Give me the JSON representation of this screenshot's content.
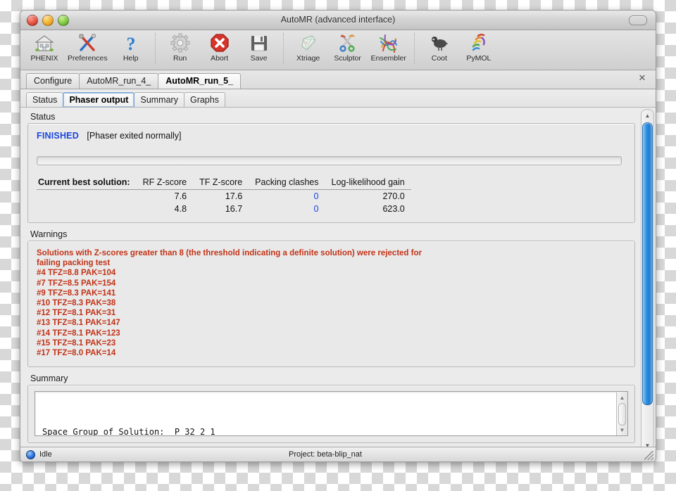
{
  "window": {
    "title": "AutoMR (advanced interface)",
    "traffic_lights": [
      "close",
      "minimize",
      "zoom"
    ],
    "toolbar_toggle": "toolbar-toggle"
  },
  "toolbar": {
    "groups": [
      {
        "items": [
          {
            "label": "PHENIX",
            "icon": "house-icon"
          },
          {
            "label": "Preferences",
            "icon": "tools-icon"
          },
          {
            "label": "Help",
            "icon": "question-mark-icon"
          }
        ]
      },
      {
        "items": [
          {
            "label": "Run",
            "icon": "gear-icon"
          },
          {
            "label": "Abort",
            "icon": "stop-x-icon"
          },
          {
            "label": "Save",
            "icon": "floppy-disk-icon"
          }
        ]
      },
      {
        "items": [
          {
            "label": "Xtriage",
            "icon": "crystal-icon"
          },
          {
            "label": "Sculptor",
            "icon": "scissors-icon"
          },
          {
            "label": "Ensembler",
            "icon": "tangle-icon"
          }
        ]
      },
      {
        "items": [
          {
            "label": "Coot",
            "icon": "bird-icon"
          },
          {
            "label": "PyMOL",
            "icon": "helix-icon"
          }
        ]
      }
    ]
  },
  "tabs": {
    "items": [
      {
        "label": "Configure",
        "active": false
      },
      {
        "label": "AutoMR_run_4_",
        "active": false
      },
      {
        "label": "AutoMR_run_5_",
        "active": true
      }
    ],
    "close_label": "✕"
  },
  "subtabs": {
    "items": [
      {
        "label": "Status",
        "active": false
      },
      {
        "label": "Phaser output",
        "active": true
      },
      {
        "label": "Summary",
        "active": false
      },
      {
        "label": "Graphs",
        "active": false
      }
    ]
  },
  "status_group": {
    "title": "Status",
    "state": "FINISHED",
    "state_color": "#1a46e0",
    "message": "[Phaser exited normally]",
    "progress_percent": 0,
    "table": {
      "lead_header": "Current best solution:",
      "headers": [
        "RF Z-score",
        "TF Z-score",
        "Packing clashes",
        "Log-likelihood gain"
      ],
      "rows": [
        {
          "rf": "7.6",
          "tf": "17.6",
          "clashes": "0",
          "llg": "270.0"
        },
        {
          "rf": "4.8",
          "tf": "16.7",
          "clashes": "0",
          "llg": "623.0"
        }
      ]
    }
  },
  "warnings_group": {
    "title": "Warnings",
    "color": "#c23216",
    "text": "Solutions with Z-scores greater than 8 (the threshold indicating a definite solution) were rejected for\nfailing packing test\n#4 TFZ=8.8 PAK=104\n#7 TFZ=8.5 PAK=154\n#9 TFZ=8.3 PAK=141\n#10 TFZ=8.3 PAK=38\n#12 TFZ=8.1 PAK=31\n#13 TFZ=8.1 PAK=147\n#14 TFZ=8.1 PAK=123\n#15 TFZ=8.1 PAK=23\n#17 TFZ=8.0 PAK=14"
  },
  "summary_group": {
    "title": "Summary",
    "text": "Space Group of Solution:  P 32 2 1"
  },
  "scrollbar": {
    "up_arrow": "▲",
    "down_arrow": "▼"
  },
  "statusbar": {
    "state": "Idle",
    "project": "Project: beta-blip_nat"
  }
}
